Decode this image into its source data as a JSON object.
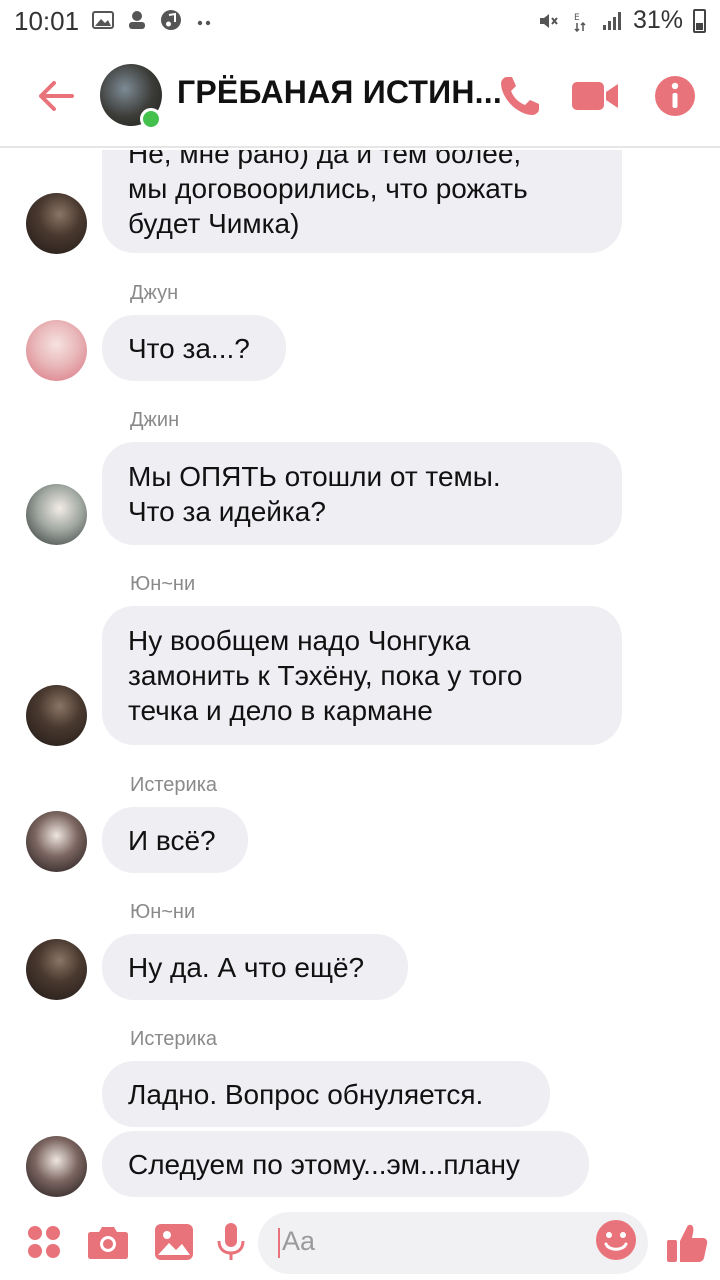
{
  "status_bar": {
    "time": "10:01",
    "battery": "31%"
  },
  "header": {
    "title": "ГРЁБАНАЯ ИСТИН...",
    "accent_color": "#e8737a",
    "online_color": "#44c04c"
  },
  "messages": [
    {
      "sender": "",
      "text": "Не, мне рано) да и тем более,\nмы договоорились, что рожать\nбудет Чимка)"
    },
    {
      "sender": "Джун",
      "text": "Что за...?"
    },
    {
      "sender": "Джин",
      "text": "Мы ОПЯТЬ отошли от темы.\nЧто за идейка?"
    },
    {
      "sender": "Юн~ни",
      "text": "Ну вообщем надо Чонгука\nзамонить к Тэхёну, пока у того\nтечка и дело в кармане"
    },
    {
      "sender": "Истерика",
      "text": "И всё?"
    },
    {
      "sender": "Юн~ни",
      "text": "Ну да. А что ещё?"
    },
    {
      "sender": "Истерика",
      "text": "Ладно. Вопрос обнуляется."
    },
    {
      "sender": "",
      "text": "Следуем по этому...эм...плану"
    }
  ],
  "composer": {
    "placeholder": "Aa"
  },
  "icons": {
    "back": "arrow-left-icon",
    "call": "phone-icon",
    "video": "video-camera-icon",
    "info": "info-icon",
    "apps": "four-dots-icon",
    "camera": "camera-icon",
    "gallery": "image-icon",
    "mic": "microphone-icon",
    "emoji": "smiley-icon",
    "like": "thumbs-up-icon"
  }
}
